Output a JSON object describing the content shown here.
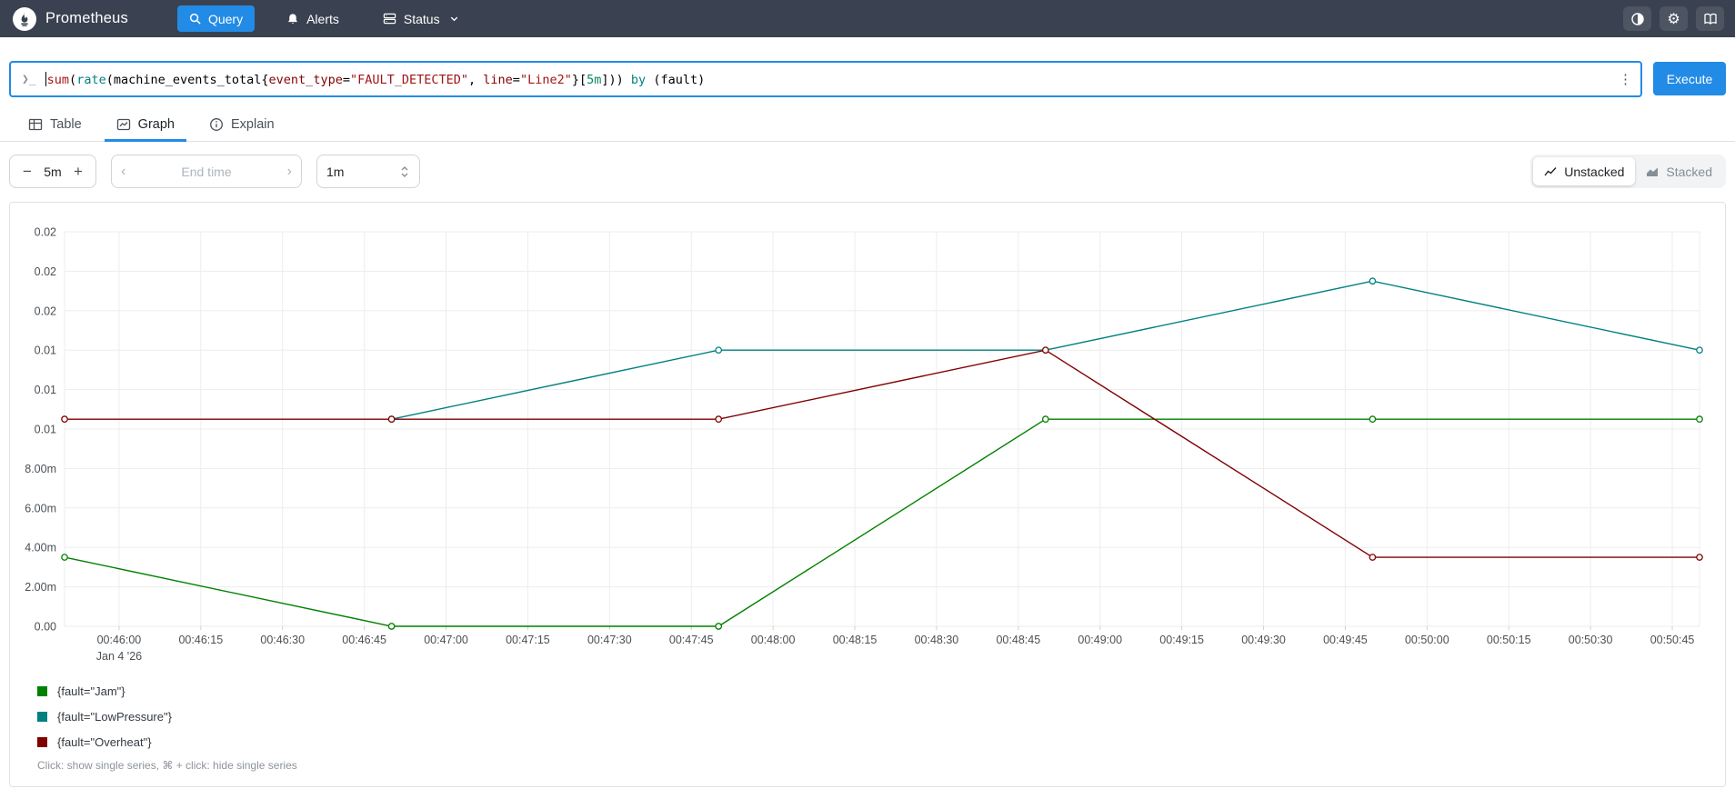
{
  "colors": {
    "accent": "#228be6",
    "header_bg": "#3a4150"
  },
  "header": {
    "brand": "Prometheus",
    "nav": {
      "query": "Query",
      "alerts": "Alerts",
      "status": "Status"
    }
  },
  "query_bar": {
    "tokens": [
      {
        "t": "sum",
        "c": "kw"
      },
      {
        "t": "(",
        "c": "p"
      },
      {
        "t": "rate",
        "c": "fn"
      },
      {
        "t": "(",
        "c": "p"
      },
      {
        "t": "machine_events_total",
        "c": "m"
      },
      {
        "t": "{",
        "c": "p"
      },
      {
        "t": "event_type",
        "c": "lbl"
      },
      {
        "t": "=",
        "c": "p"
      },
      {
        "t": "\"FAULT_DETECTED\"",
        "c": "str"
      },
      {
        "t": ", ",
        "c": "p"
      },
      {
        "t": "line",
        "c": "lbl"
      },
      {
        "t": "=",
        "c": "p"
      },
      {
        "t": "\"Line2\"",
        "c": "str"
      },
      {
        "t": "}",
        "c": "p"
      },
      {
        "t": "[",
        "c": "p"
      },
      {
        "t": "5m",
        "c": "dur"
      },
      {
        "t": "]",
        "c": "p"
      },
      {
        "t": ")) ",
        "c": "p"
      },
      {
        "t": "by",
        "c": "fn"
      },
      {
        "t": " (fault)",
        "c": "p"
      }
    ],
    "menu_icon": "⋮",
    "execute": "Execute"
  },
  "tabs": {
    "table": "Table",
    "graph": "Graph",
    "explain": "Explain"
  },
  "controls": {
    "range_minus": "−",
    "range": "5m",
    "range_plus": "+",
    "end_time_prev": "‹",
    "end_time_placeholder": "End time",
    "end_time_next": "›",
    "resolution": "1m",
    "unstacked": "Unstacked",
    "stacked": "Stacked"
  },
  "chart_data": {
    "type": "line",
    "x_range": [
      0,
      300
    ],
    "y_range": [
      0,
      0.02
    ],
    "grid": true,
    "legend_position": "bottom-left",
    "y_axis": {
      "ticks": [
        {
          "v": 0.02,
          "label": "0.02"
        },
        {
          "v": 0.018,
          "label": "0.02"
        },
        {
          "v": 0.016,
          "label": "0.02"
        },
        {
          "v": 0.014,
          "label": "0.01"
        },
        {
          "v": 0.012,
          "label": "0.01"
        },
        {
          "v": 0.01,
          "label": "0.01"
        },
        {
          "v": 0.008,
          "label": "8.00m"
        },
        {
          "v": 0.006,
          "label": "6.00m"
        },
        {
          "v": 0.004,
          "label": "4.00m"
        },
        {
          "v": 0.002,
          "label": "2.00m"
        },
        {
          "v": 0.0,
          "label": "0.00"
        }
      ]
    },
    "x_axis": {
      "ticks": [
        {
          "t": 10,
          "label": "00:46:00",
          "sub": "Jan 4 '26"
        },
        {
          "t": 25,
          "label": "00:46:15"
        },
        {
          "t": 40,
          "label": "00:46:30"
        },
        {
          "t": 55,
          "label": "00:46:45"
        },
        {
          "t": 70,
          "label": "00:47:00"
        },
        {
          "t": 85,
          "label": "00:47:15"
        },
        {
          "t": 100,
          "label": "00:47:30"
        },
        {
          "t": 115,
          "label": "00:47:45"
        },
        {
          "t": 130,
          "label": "00:48:00"
        },
        {
          "t": 145,
          "label": "00:48:15"
        },
        {
          "t": 160,
          "label": "00:48:30"
        },
        {
          "t": 175,
          "label": "00:48:45"
        },
        {
          "t": 190,
          "label": "00:49:00"
        },
        {
          "t": 205,
          "label": "00:49:15"
        },
        {
          "t": 220,
          "label": "00:49:30"
        },
        {
          "t": 235,
          "label": "00:49:45"
        },
        {
          "t": 250,
          "label": "00:50:00"
        },
        {
          "t": 265,
          "label": "00:50:15"
        },
        {
          "t": 280,
          "label": "00:50:30"
        },
        {
          "t": 295,
          "label": "00:50:45"
        }
      ]
    },
    "series": [
      {
        "name": "{fault=\"Jam\"}",
        "color": "#008000",
        "points": [
          [
            0,
            0.0035
          ],
          [
            60,
            0.0
          ],
          [
            120,
            0.0
          ],
          [
            180,
            0.0105
          ],
          [
            240,
            0.0105
          ],
          [
            300,
            0.0105
          ]
        ]
      },
      {
        "name": "{fault=\"LowPressure\"}",
        "color": "#008080",
        "points": [
          [
            60,
            0.0105
          ],
          [
            120,
            0.014
          ],
          [
            180,
            0.014
          ],
          [
            240,
            0.0175
          ],
          [
            300,
            0.014
          ]
        ]
      },
      {
        "name": "{fault=\"Overheat\"}",
        "color": "#800000",
        "points": [
          [
            0,
            0.0105
          ],
          [
            60,
            0.0105
          ],
          [
            120,
            0.0105
          ],
          [
            180,
            0.014
          ],
          [
            240,
            0.0035
          ],
          [
            300,
            0.0035
          ]
        ]
      }
    ]
  },
  "legend_note": "Click: show single series, ⌘ + click: hide single series"
}
